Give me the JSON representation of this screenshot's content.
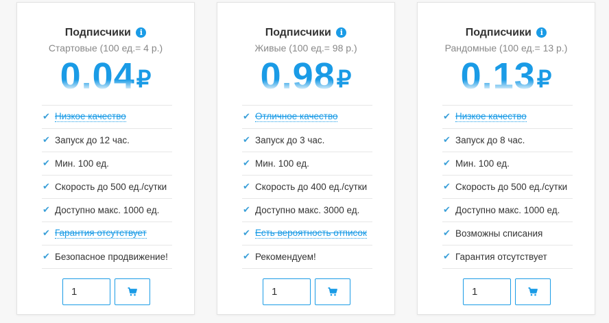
{
  "colors": {
    "accent": "#1a9be6",
    "check": "#3a9fd8",
    "text": "#333333",
    "muted": "#888888",
    "border": "#e6e6e6"
  },
  "currency_symbol": "₽",
  "cards": [
    {
      "title": "Подписчики",
      "subtitle": "Стартовые (100 ед.= 4 р.)",
      "price": "0.04",
      "features": [
        {
          "text": "Низкое качество",
          "struck": true
        },
        {
          "text": "Запуск до 12 час.",
          "struck": false
        },
        {
          "text": "Мин. 100 ед.",
          "struck": false
        },
        {
          "text": "Скорость до 500 ед./сутки",
          "struck": false
        },
        {
          "text": "Доступно макс. 1000 ед.",
          "struck": false
        },
        {
          "text": "Гарантия отсутствует",
          "struck": true
        },
        {
          "text": "Безопасное продвижение!",
          "struck": false
        }
      ],
      "quantity": "1"
    },
    {
      "title": "Подписчики",
      "subtitle": "Живые (100 ед.= 98 р.)",
      "price": "0.98",
      "features": [
        {
          "text": "Отличное качество",
          "struck": true
        },
        {
          "text": "Запуск до 3 час.",
          "struck": false
        },
        {
          "text": "Мин. 100 ед.",
          "struck": false
        },
        {
          "text": "Скорость до 400 ед./сутки",
          "struck": false
        },
        {
          "text": "Доступно макс. 3000 ед.",
          "struck": false
        },
        {
          "text": "Есть вероятность отписок",
          "struck": true
        },
        {
          "text": "Рекомендуем!",
          "struck": false
        }
      ],
      "quantity": "1"
    },
    {
      "title": "Подписчики",
      "subtitle": "Рандомные (100 ед.= 13 р.)",
      "price": "0.13",
      "features": [
        {
          "text": "Низкое качество",
          "struck": true
        },
        {
          "text": "Запуск до 8 час.",
          "struck": false
        },
        {
          "text": "Мин. 100 ед.",
          "struck": false
        },
        {
          "text": "Скорость до 500 ед./сутки",
          "struck": false
        },
        {
          "text": "Доступно макс. 1000 ед.",
          "struck": false
        },
        {
          "text": "Возможны списания",
          "struck": false
        },
        {
          "text": "Гарантия отсутствует",
          "struck": false
        }
      ],
      "quantity": "1"
    }
  ]
}
